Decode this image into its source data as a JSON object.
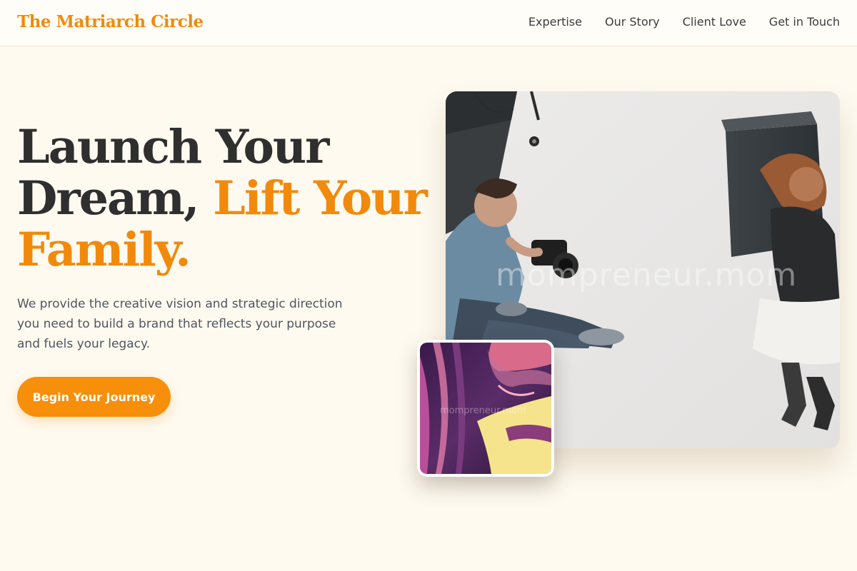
{
  "nav": {
    "brand": "The Matriarch Circle",
    "links": [
      "Expertise",
      "Our Story",
      "Client Love",
      "Get in Touch"
    ]
  },
  "hero": {
    "headline_plain": "Launch Your Dream, ",
    "headline_accent": "Lift Your Family.",
    "lede": "We provide the creative vision and strategic direction you need to build a brand that reflects your purpose and fuels your legacy.",
    "cta_label": "Begin Your Journey"
  },
  "media": {
    "photo_watermark": "mompreneur.mom",
    "inset_watermark": "mompreneur.mom"
  },
  "colors": {
    "accent": "#f18a0c",
    "cta": "#f78f0a",
    "page_bg": "#fefaf0",
    "heading": "#2f2f2f",
    "body_text": "#4f5560"
  }
}
